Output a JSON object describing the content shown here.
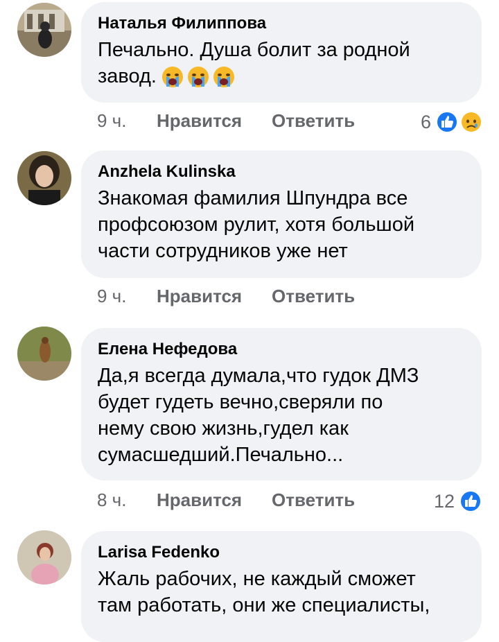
{
  "comments": [
    {
      "author": "Наталья Филиппова",
      "text": "Печально. Душа болит за родной\nзавод.",
      "emoji": [
        "crying-face",
        "crying-face",
        "crying-face"
      ],
      "time": "9 ч.",
      "like_label": "Нравится",
      "reply_label": "Ответить",
      "reaction_count": "6",
      "reactions": [
        "like",
        "sad"
      ]
    },
    {
      "author": "Anzhela Kulinska",
      "text": "Знакомая фамилия Шпундра все\nпрофсоюзом рулит, хотя большой\nчасти сотрудников уже нет",
      "time": "9 ч.",
      "like_label": "Нравится",
      "reply_label": "Ответить"
    },
    {
      "author": "Елена Нефедова",
      "text": "Да,я всегда думала,что гудок ДМЗ\nбудет гудеть вечно,сверяли по\nнему свою жизнь,гудел как\nсумасшедший.Печально...",
      "time": "8 ч.",
      "like_label": "Нравится",
      "reply_label": "Ответить",
      "reaction_count": "12",
      "reactions": [
        "like"
      ]
    },
    {
      "author": "Larisa Fedenko",
      "text": "Жаль рабочих, не каждый сможет\nтам работать, они же специалисты,"
    }
  ],
  "colors": {
    "bubble": "#f0f2f5",
    "like_blue": "#1877f2",
    "muted": "#65676b",
    "sad_yellow": "#f7b928"
  }
}
